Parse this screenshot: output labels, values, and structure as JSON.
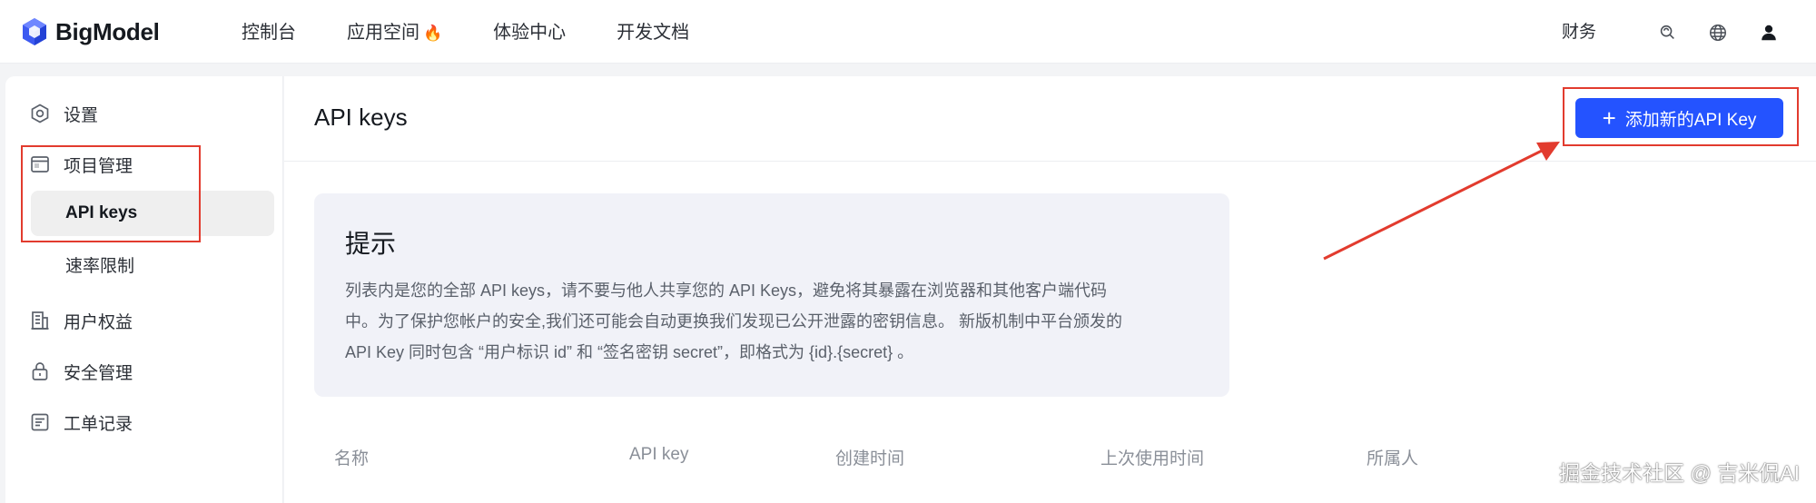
{
  "brand": {
    "name": "BigModel",
    "accent": "#2453ff"
  },
  "nav": {
    "items": [
      {
        "label": "控制台"
      },
      {
        "label": "应用空间",
        "badge": "🔥"
      },
      {
        "label": "体验中心"
      },
      {
        "label": "开发文档"
      }
    ]
  },
  "top_right": {
    "finance_label": "财务",
    "icons": [
      "support-icon",
      "globe-icon",
      "user-icon"
    ]
  },
  "sidebar": {
    "items": [
      {
        "label": "设置",
        "icon": "settings-icon"
      },
      {
        "label": "项目管理",
        "icon": "project-icon"
      },
      {
        "label": "API keys",
        "active": true
      },
      {
        "label": "速率限制"
      },
      {
        "label": "用户权益",
        "icon": "building-icon"
      },
      {
        "label": "安全管理",
        "icon": "lock-icon"
      },
      {
        "label": "工单记录",
        "icon": "ticket-icon"
      }
    ]
  },
  "main": {
    "title": "API keys",
    "add_button": "添加新的API Key",
    "notice": {
      "title": "提示",
      "line1": "列表内是您的全部 API keys，请不要与他人共享您的 API Keys，避免将其暴露在浏览器和其他客户端代码",
      "line2": "中。为了保护您帐户的安全,我们还可能会自动更换我们发现已公开泄露的密钥信息。 新版机制中平台颁发的",
      "line3": "API Key 同时包含 “用户标识 id” 和 “签名密钥 secret”，即格式为 {id}.{secret} 。"
    },
    "table": {
      "columns": [
        "名称",
        "API key",
        "创建时间",
        "上次使用时间",
        "所属人"
      ]
    }
  },
  "watermark": "掘金技术社区 @ 吉米侃AI"
}
